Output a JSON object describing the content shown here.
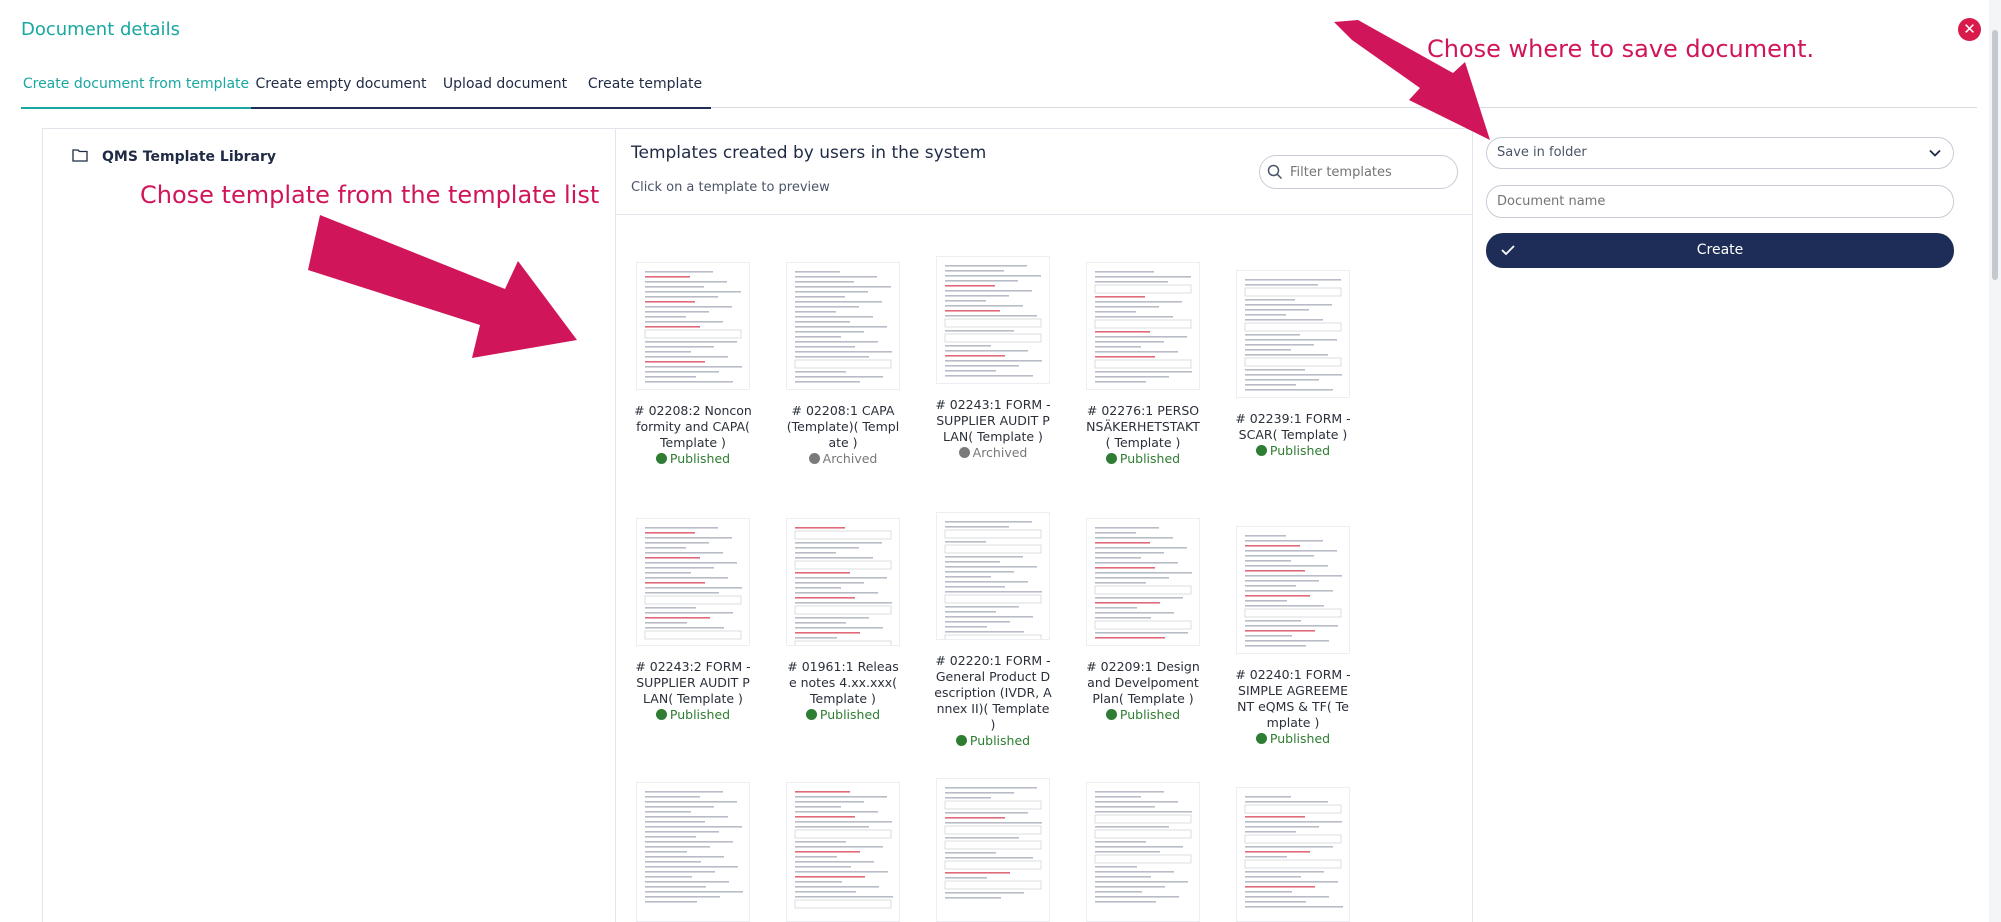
{
  "title": "Document details",
  "tabs": [
    {
      "label": "Create document from template",
      "active": true
    },
    {
      "label": "Create empty document",
      "active": false
    },
    {
      "label": "Upload document",
      "active": false
    },
    {
      "label": "Create template",
      "active": false
    }
  ],
  "library": {
    "label": "QMS Template Library"
  },
  "templates_section": {
    "title": "Templates created by users in the system",
    "subtitle": "Click on a template to preview",
    "filter_placeholder": "Filter templates"
  },
  "templates": [
    {
      "name": "# 02208:2 Nonconformity and CAPA( Template )",
      "status": "Published"
    },
    {
      "name": "# 02208:1 CAPA (Template)( Template )",
      "status": "Archived"
    },
    {
      "name": "# 02243:1 FORM - SUPPLIER AUDIT PLAN( Template )",
      "status": "Archived"
    },
    {
      "name": "# 02276:1 PERSONSÄKERHETSTAKT( Template )",
      "status": "Published"
    },
    {
      "name": "# 02239:1 FORM - SCAR( Template )",
      "status": "Published"
    },
    {
      "name": "# 02243:2 FORM - SUPPLIER AUDIT PLAN( Template )",
      "status": "Published"
    },
    {
      "name": "# 01961:1 Release notes 4.xx.xxx( Template )",
      "status": "Published"
    },
    {
      "name": "# 02220:1 FORM - General Product Description (IVDR, Annex II)( Template )",
      "status": "Published"
    },
    {
      "name": "# 02209:1 Design and Develpoment Plan( Template )",
      "status": "Published"
    },
    {
      "name": "# 02240:1 FORM - SIMPLE AGREEMENT eQMS & TF( Template )",
      "status": "Published"
    }
  ],
  "right_panel": {
    "folder_placeholder": "Save in folder",
    "name_placeholder": "Document name",
    "create_label": "Create"
  },
  "annotations": {
    "save_hint": "Chose where to save document.",
    "template_hint": "Chose template from the template list"
  },
  "colors": {
    "accent": "#19a7a1",
    "primary": "#1e2d57",
    "annotation": "#d0155a",
    "published": "#2e7d32",
    "archived": "#7a7a7a",
    "close": "#d81b4b"
  }
}
